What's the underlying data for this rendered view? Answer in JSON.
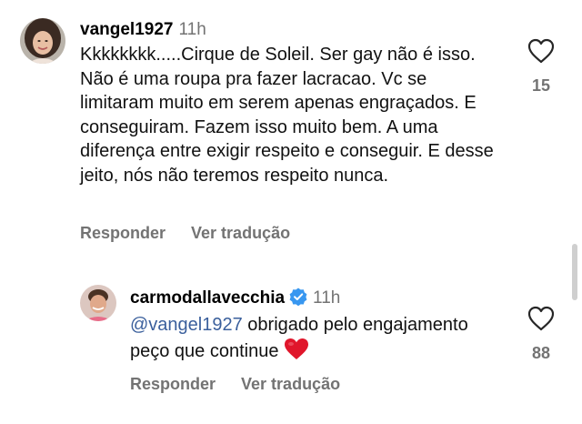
{
  "comments": [
    {
      "username": "vangel1927",
      "time": "11h",
      "text": "Kkkkkkkk.....Cirque de Soleil. Ser gay não é isso. Não é uma roupa pra fazer lacracao. Vc se limitaram muito em serem apenas engraçados. E conseguiram. Fazem isso muito bem. A uma diferença entre exigir respeito e conseguir. E desse jeito, nós não teremos respeito  nunca.",
      "likes": "15",
      "reply_label": "Responder",
      "translate_label": "Ver tradução"
    },
    {
      "username": "carmodallavecchia",
      "verified": true,
      "time": "11h",
      "mention": "@vangel1927",
      "text": " obrigado pelo engajamento peço que continue",
      "likes": "88",
      "reply_label": "Responder",
      "translate_label": "Ver tradução"
    }
  ],
  "colors": {
    "secondary_text": "#737373",
    "mention": "#3a5f9c",
    "verified_badge": "#3897f0",
    "heart_emoji": "#e0162b"
  },
  "icons": [
    "heart-outline-icon",
    "verified-badge-icon",
    "red-heart-emoji"
  ]
}
